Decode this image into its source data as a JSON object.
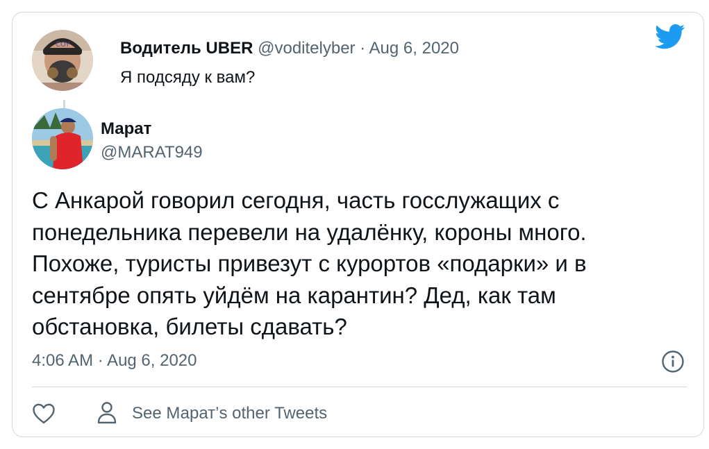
{
  "parent_tweet": {
    "display_name": "Водитель UBER",
    "meta": "@voditelyber · Aug 6, 2020",
    "text": "Я подсяду к вам?"
  },
  "main_tweet": {
    "display_name": "Марат",
    "handle": "@MARAT949",
    "text_lines": [
      "С Анкарой говорил сегодня, часть госслужащих с",
      "понедельника перевели на удалёнку, короны много.",
      "Похоже, туристы привезут с курортов «подарки» и в",
      "сентябре опять уйдём на карантин? Дед, как там",
      "обстановка, билеты сдавать?"
    ],
    "timestamp": "4:06 AM · Aug 6, 2020"
  },
  "actions": {
    "see_other_label": "See Марат’s other Tweets"
  },
  "icons": {
    "brand": "twitter-bird-icon",
    "info": "info-icon",
    "like": "heart-icon",
    "profile": "person-icon"
  },
  "colors": {
    "brand": "#1d9bf0",
    "text_primary": "#0f1419",
    "text_secondary": "#536471",
    "border": "#cfd9de"
  }
}
